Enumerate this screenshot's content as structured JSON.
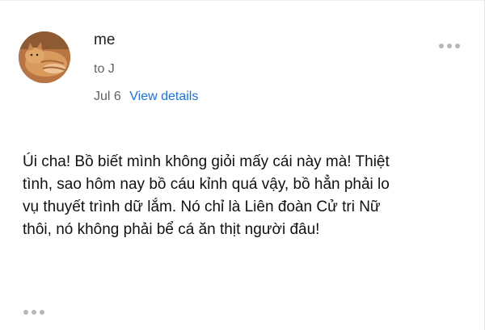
{
  "header": {
    "sender": "me",
    "recipient": "to J",
    "date": "Jul 6",
    "view_details_label": "View details",
    "avatar_icon": "cat-photo-avatar",
    "more_icon": "more-horizontal-icon"
  },
  "message": {
    "body": "Úi cha! Bồ biết mình không giỏi mấy cái này mà! Thiệt\ntình, sao hôm nay bồ cáu kỉnh quá vậy, bồ hẳn phải lo\nvụ thuyết trình dữ lắm. Nó chỉ là Liên đoàn Cử tri Nữ\nthôi, nó không phải bể cá ăn thịt người đâu!"
  },
  "footer": {
    "more_icon": "more-horizontal-icon"
  },
  "colors": {
    "link": "#1a73e8",
    "secondary_text": "#5f6368",
    "primary_text": "#202124"
  }
}
